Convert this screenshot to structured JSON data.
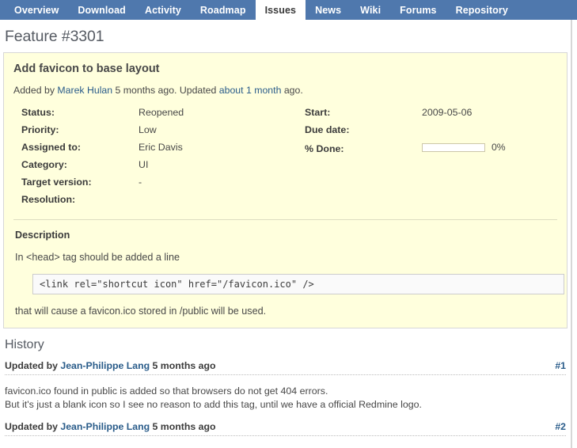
{
  "tabs": [
    {
      "label": "Overview",
      "active": false
    },
    {
      "label": "Download",
      "active": false
    },
    {
      "label": "Activity",
      "active": false
    },
    {
      "label": "Roadmap",
      "active": false
    },
    {
      "label": "Issues",
      "active": true
    },
    {
      "label": "News",
      "active": false
    },
    {
      "label": "Wiki",
      "active": false
    },
    {
      "label": "Forums",
      "active": false
    },
    {
      "label": "Repository",
      "active": false
    }
  ],
  "page": {
    "title": "Feature #3301"
  },
  "issue": {
    "subject": "Add favicon to base layout",
    "author_prefix": "Added by ",
    "author_name": "Marek Hulan",
    "author_suffix": " 5 months ago. Updated ",
    "updated_rel": "about 1 month",
    "author_tail": " ago.",
    "attributes_left": [
      {
        "label": "Status:",
        "value": "Reopened",
        "is_link": false
      },
      {
        "label": "Priority:",
        "value": "Low",
        "is_link": false
      },
      {
        "label": "Assigned to:",
        "value": "Eric Davis",
        "is_link": true
      },
      {
        "label": "Category:",
        "value": "UI",
        "is_link": false
      },
      {
        "label": "Target version:",
        "value": "-",
        "is_link": false
      },
      {
        "label": "Resolution:",
        "value": "",
        "is_link": false
      }
    ],
    "attributes_right": [
      {
        "label": "Start:",
        "value": "2009-05-06"
      },
      {
        "label": "Due date:",
        "value": ""
      }
    ],
    "done": {
      "label": "% Done:",
      "percent": 0,
      "percent_text": "0%"
    },
    "description": {
      "heading": "Description",
      "line1": "In <head> tag should be added a line",
      "code": "<link rel=\"shortcut icon\" href=\"/favicon.ico\" />",
      "line2": "that will cause a favicon.ico stored in /public will be used."
    }
  },
  "history": {
    "title": "History",
    "entries": [
      {
        "prefix": "Updated by ",
        "author": "Jean-Philippe Lang",
        "suffix": " 5 months ago",
        "anchor": "#1",
        "note_line1": "favicon.ico found in public is added so that browsers do not get 404 errors.",
        "note_line2": "But it's just a blank icon so I see no reason to add this tag, until we have a official Redmine logo."
      },
      {
        "prefix": "Updated by ",
        "author": "Jean-Philippe Lang",
        "suffix": " 5 months ago",
        "anchor": "#2",
        "note_line1": "",
        "note_line2": ""
      }
    ]
  },
  "colors": {
    "nav_blue": "#4f78ad",
    "issue_bg": "#ffffdd",
    "link_blue": "#2a5c8a",
    "text": "#484848",
    "border": "#d7d7d7"
  }
}
